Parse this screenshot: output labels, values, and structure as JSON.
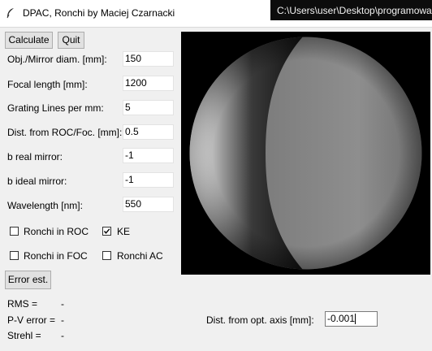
{
  "window": {
    "title": "DPAC, Ronchi by Maciej Czarnacki",
    "console_title": "C:\\Users\\user\\Desktop\\programowa",
    "icon": "feather-icon"
  },
  "toolbar": {
    "calculate_label": "Calculate",
    "quit_label": "Quit"
  },
  "params": [
    {
      "label": "Obj./Mirror diam. [mm]:",
      "value": "150"
    },
    {
      "label": "Focal length [mm]:",
      "value": "1200"
    },
    {
      "label": "Grating Lines per mm:",
      "value": "5"
    },
    {
      "label": "Dist. from ROC/Foc. [mm]:",
      "value": "0.5"
    },
    {
      "label": "b real mirror:",
      "value": "-1"
    },
    {
      "label": "b ideal mirror:",
      "value": "-1"
    },
    {
      "label": "Wavelength [nm]:",
      "value": "550"
    }
  ],
  "options": [
    {
      "label": "Ronchi in ROC",
      "checked": false
    },
    {
      "label": "KE",
      "checked": true
    },
    {
      "label": "Ronchi in FOC",
      "checked": false
    },
    {
      "label": "Ronchi AC",
      "checked": false
    }
  ],
  "error_button_label": "Error est.",
  "results": [
    {
      "label": "RMS =",
      "value": "-"
    },
    {
      "label": "P-V error =",
      "value": "-"
    },
    {
      "label": "Strehl =",
      "value": "-"
    }
  ],
  "axis_distance": {
    "label": "Dist. from opt. axis [mm]:",
    "value": "-0.001"
  }
}
